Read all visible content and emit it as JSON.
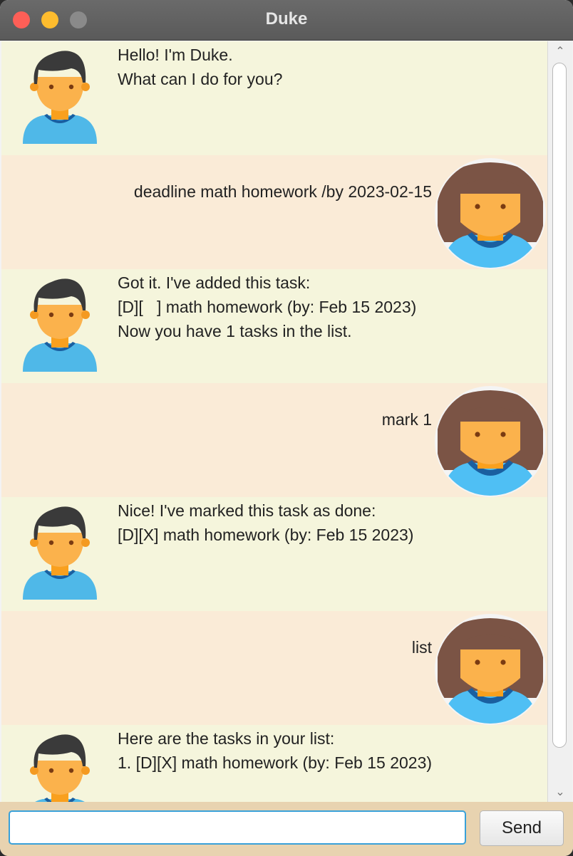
{
  "window": {
    "title": "Duke"
  },
  "messages": [
    {
      "sender": "duke",
      "text": "Hello! I'm Duke.\nWhat can I do for you?"
    },
    {
      "sender": "user",
      "text": "deadline math homework /by 2023-02-15"
    },
    {
      "sender": "duke",
      "text": "Got it. I've added this task:\n[D][   ] math homework (by: Feb 15 2023)\nNow you have 1 tasks in the list."
    },
    {
      "sender": "user",
      "text": "mark 1"
    },
    {
      "sender": "duke",
      "text": "Nice! I've marked this task as done:\n[D][X] math homework (by: Feb 15 2023)"
    },
    {
      "sender": "user",
      "text": "list"
    },
    {
      "sender": "duke",
      "text": "Here are the tasks in your list:\n1. [D][X] math homework (by: Feb 15 2023)"
    }
  ],
  "input": {
    "value": "",
    "placeholder": ""
  },
  "send_button": {
    "label": "Send"
  },
  "colors": {
    "duke_row": "#f5f5dc",
    "user_row": "#faebd7",
    "input_border": "#39a1d9",
    "input_bar": "#e8d3b0"
  },
  "icons": {
    "duke_avatar": "duke-avatar-icon",
    "user_avatar": "user-avatar-icon"
  }
}
